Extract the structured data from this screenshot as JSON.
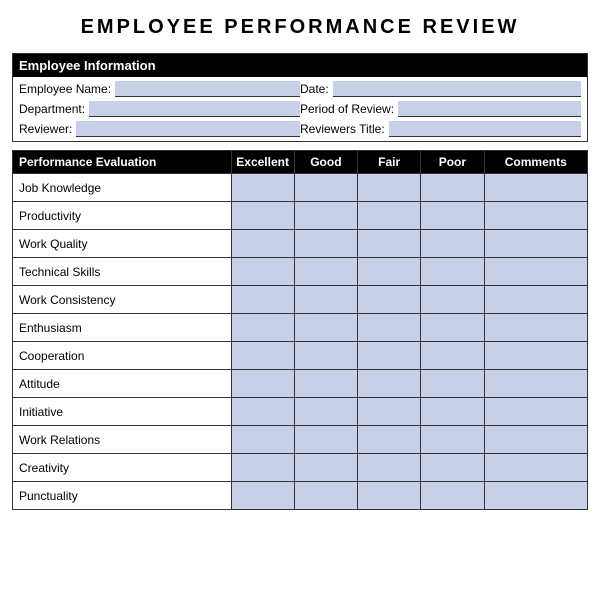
{
  "title": "EMPLOYEE PERFORMANCE REVIEW",
  "employeeInfo": {
    "header": "Employee Information",
    "fields": [
      {
        "label": "Employee Name:",
        "value": ""
      },
      {
        "label": "Date:",
        "value": ""
      },
      {
        "label": "Department:",
        "value": ""
      },
      {
        "label": "Period of Review:",
        "value": ""
      },
      {
        "label": "Reviewer:",
        "value": ""
      },
      {
        "label": "Reviewers Title:",
        "value": ""
      }
    ]
  },
  "evalTable": {
    "headers": {
      "category": "Performance Evaluation",
      "excellent": "Excellent",
      "good": "Good",
      "fair": "Fair",
      "poor": "Poor",
      "comments": "Comments"
    },
    "rows": [
      "Job Knowledge",
      "Productivity",
      "Work Quality",
      "Technical Skills",
      "Work Consistency",
      "Enthusiasm",
      "Cooperation",
      "Attitude",
      "Initiative",
      "Work Relations",
      "Creativity",
      "Punctuality"
    ]
  }
}
